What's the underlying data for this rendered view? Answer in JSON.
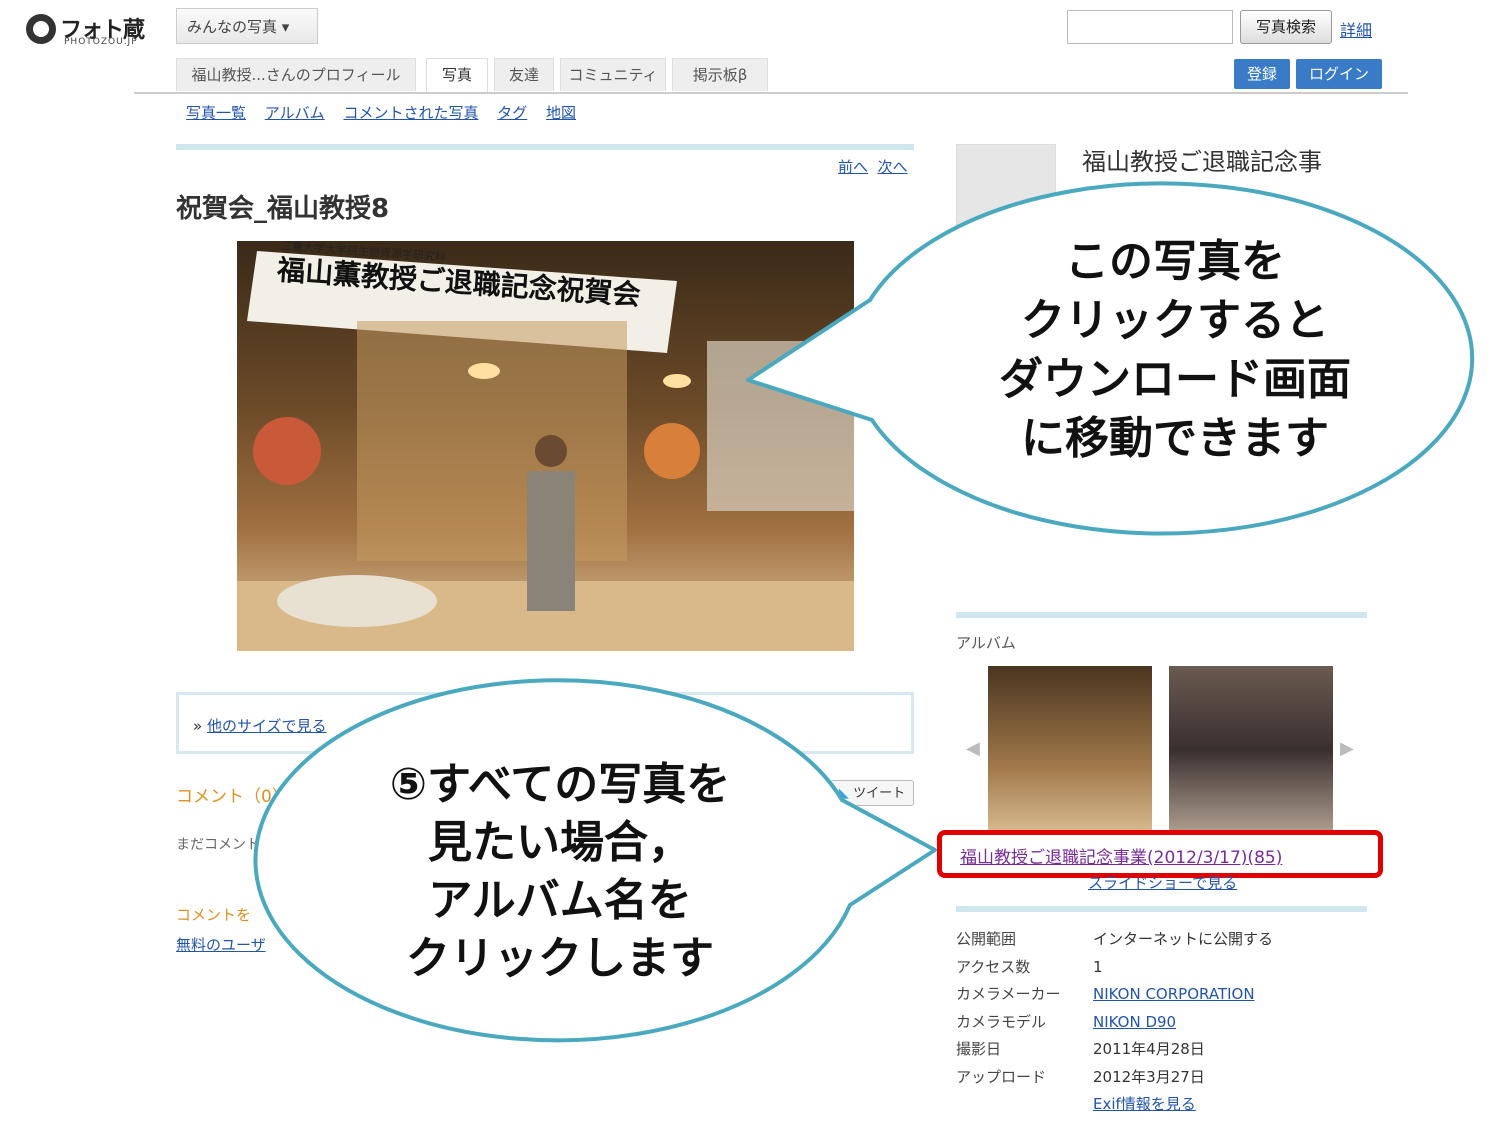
{
  "header": {
    "logo_text": "フォト蔵",
    "logo_sub": "PHOTOZOU.JP",
    "dropdown_label": "みんなの写真 ▾",
    "search_button": "写真検索",
    "detail_link": "詳細",
    "register_button": "登録",
    "login_button": "ログイン"
  },
  "tabs": [
    {
      "label": "福山教授...さんのプロフィール"
    },
    {
      "label": "写真"
    },
    {
      "label": "友達"
    },
    {
      "label": "コミュニティ"
    },
    {
      "label": "掲示板β"
    }
  ],
  "subnav": [
    "写真一覧",
    "アルバム",
    "コメントされた写真",
    "タグ",
    "地図"
  ],
  "nav": {
    "prev": "前へ",
    "next": "次へ"
  },
  "photo": {
    "title": "祝賀会_福山教授8",
    "banner_line1": "三重大学大学院生物資源学研究科",
    "banner_line2": "福山薫教授ご退職記念祝賀会"
  },
  "other_size": {
    "prefix": "»",
    "link": "他のサイズで見る"
  },
  "comments": {
    "heading": "コメント（0）",
    "tweet": "ツイート",
    "empty": "まだコメント",
    "login_heading": "コメントを",
    "free_user": "無料のユーザ"
  },
  "sidebar": {
    "album_title_top": "福山教授ご退職記念事",
    "album_label": "アルバム",
    "album_link": "福山教授ご退職記念事業(2012/3/17)(85)",
    "slideshow": "スライドショーで見る",
    "info": [
      {
        "key": "公開範囲",
        "value": "インターネットに公開する",
        "link": false
      },
      {
        "key": "アクセス数",
        "value": "1",
        "link": false
      },
      {
        "key": "カメラメーカー",
        "value": "NIKON CORPORATION",
        "link": true
      },
      {
        "key": "カメラモデル",
        "value": "NIKON D90",
        "link": true
      },
      {
        "key": "撮影日",
        "value": "2011年4月28日",
        "link": false
      },
      {
        "key": "アップロード",
        "value": "2012年3月27日",
        "link": false
      },
      {
        "key": "",
        "value": "Exif情報を見る",
        "link": true
      }
    ]
  },
  "callouts": {
    "top_lines": [
      "この写真を",
      "クリックすると",
      "ダウンロード画面",
      "に移動できます"
    ],
    "bottom_lines": [
      "⑤すべての写真を",
      "見たい場合，",
      "アルバム名を",
      "クリックします"
    ]
  },
  "colors": {
    "accent_blue": "#3a7bc8",
    "callout_border": "#4aa8bf",
    "highlight_red": "#e00000",
    "comment_orange": "#e09020"
  }
}
